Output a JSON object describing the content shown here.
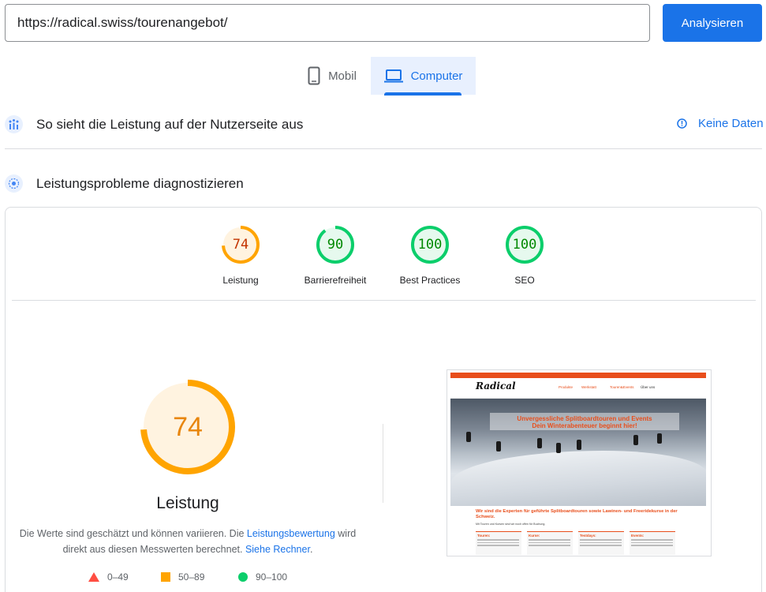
{
  "search": {
    "url_value": "https://radical.swiss/tourenangebot/",
    "analyze_label": "Analysieren"
  },
  "tabs": [
    {
      "label": "Mobil",
      "icon": "smartphone-icon",
      "active": false
    },
    {
      "label": "Computer",
      "icon": "laptop-icon",
      "active": true
    }
  ],
  "field_data": {
    "title": "So sieht die Leistung auf der Nutzerseite aus",
    "no_data_label": "Keine Daten"
  },
  "diagnose": {
    "title": "Leistungsprobleme diagnostizieren"
  },
  "categories": [
    {
      "label": "Leistung",
      "score": "74",
      "value": 74,
      "color": "#ffa400",
      "fill": "#fff3e0",
      "text_color": "#c33300"
    },
    {
      "label": "Barrierefreiheit",
      "score": "90",
      "value": 90,
      "color": "#0cce6b",
      "fill": "#e6f9ee",
      "text_color": "#008800"
    },
    {
      "label": "Best Practices",
      "score": "100",
      "value": 100,
      "color": "#0cce6b",
      "fill": "#e6f9ee",
      "text_color": "#008800"
    },
    {
      "label": "SEO",
      "score": "100",
      "value": 100,
      "color": "#0cce6b",
      "fill": "#e6f9ee",
      "text_color": "#008800"
    }
  ],
  "performance": {
    "score": "74",
    "value": 74,
    "title": "Leistung",
    "desc_part1": "Die Werte sind geschätzt und können variieren. Die ",
    "desc_link1": "Leistungsbewertung",
    "desc_part2": " wird direkt aus diesen Messwerten berechnet. ",
    "desc_link2": "Siehe Rechner",
    "desc_part3": "."
  },
  "legend": [
    {
      "range": "0–49",
      "shape": "triangle",
      "color": "#ff4e42"
    },
    {
      "range": "50–89",
      "shape": "square",
      "color": "#ffa400"
    },
    {
      "range": "90–100",
      "shape": "circle",
      "color": "#0cce6b"
    }
  ],
  "preview": {
    "topbar": "Mein Radical   Newsletter   Blog",
    "logo": "Radical",
    "nav": [
      "Produkte",
      "Werkstatt",
      "Touren&Events",
      "Über uns"
    ],
    "hero_line1": "Unvergessliche Splitboardtouren und Events",
    "hero_line2": "Dein Winterabenteuer beginnt hier!",
    "headline": "Wir sind die Experten für geführte Splitboardtouren sowie Lawinen- und Freeridekurse in der Schweiz.",
    "sub": "Mit Touren und Kursen sind wir noch offen für Buchung.",
    "columns": [
      "Touren:",
      "Kurse:",
      "Testdays:",
      "Events:"
    ]
  },
  "colors": {
    "accent": "#1a73e8",
    "average": "#ffa400",
    "pass": "#0cce6b",
    "fail": "#ff4e42"
  }
}
